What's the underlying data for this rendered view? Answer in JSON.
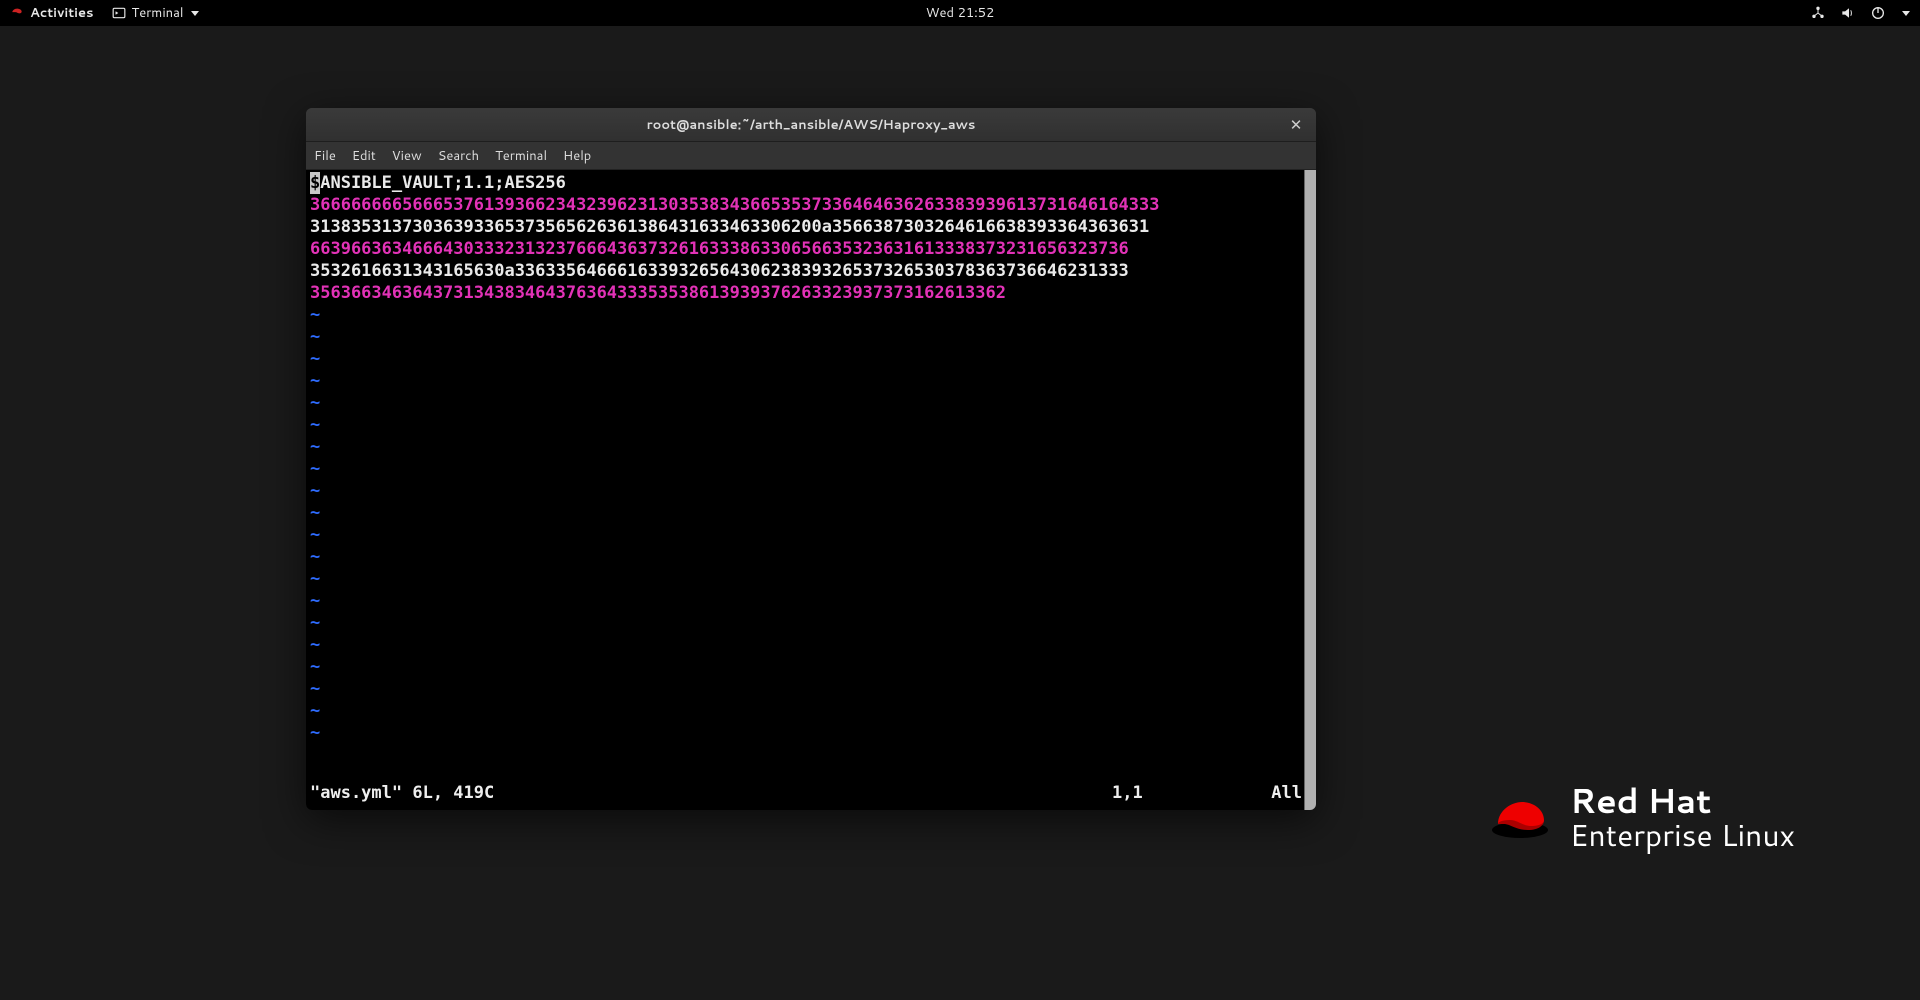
{
  "topbar": {
    "activities_label": "Activities",
    "app_name": "Terminal",
    "clock": "Wed 21:52"
  },
  "window": {
    "title": "root@ansible:~/arth_ansible/AWS/Haproxy_aws"
  },
  "menubar": {
    "items": [
      "File",
      "Edit",
      "View",
      "Search",
      "Terminal",
      "Help"
    ]
  },
  "editor": {
    "cursor_char": "$",
    "header_rest": "ANSIBLE_VAULT;1.1;AES256",
    "lines": [
      {
        "color": "pink",
        "text": "36666666656665376139366234323962313035383436653537336464636263383939613731646164333"
      },
      {
        "color": "white",
        "text": "31383531373036393365373565626361386431633463306200a3566387303264616638393364363631"
      },
      {
        "color": "pink",
        "text": "66396636346664303332313237666436373261633386330656635323631613338373231656323736"
      },
      {
        "color": "white",
        "text": "3532616631343165630a336335646661633932656430623839326537326530378363736646231333"
      },
      {
        "color": "pink",
        "text": "35636634636437313438346437636433353538613939376263323937373162613362"
      }
    ],
    "tilde_rows": 20,
    "status": {
      "file": "\"aws.yml\" 6L, 419C",
      "position": "1,1",
      "percent": "All"
    }
  },
  "brand": {
    "line1": "Red Hat",
    "line2": "Enterprise Linux"
  }
}
